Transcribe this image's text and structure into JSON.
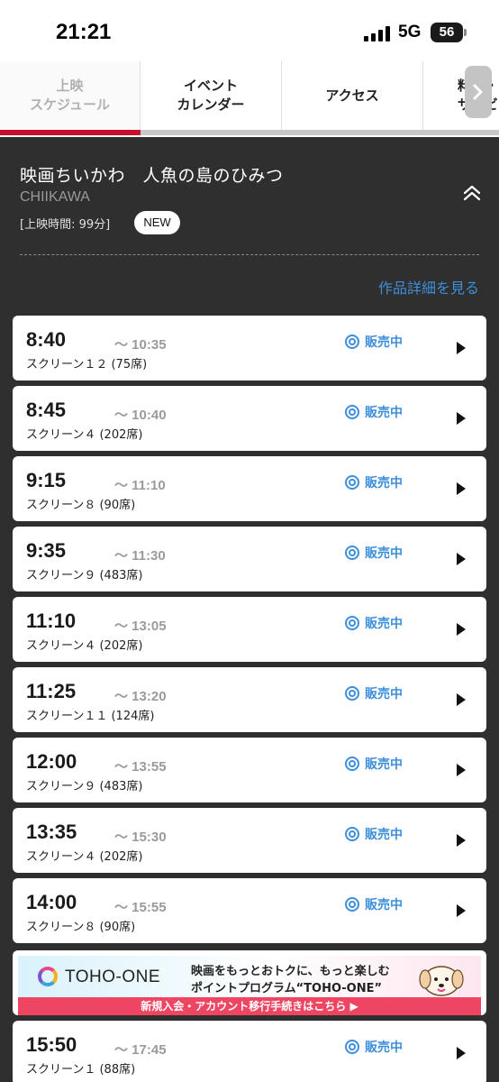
{
  "status_bar": {
    "time": "21:21",
    "network": "5G",
    "battery": "56"
  },
  "tabs": [
    {
      "label": "上映\nスケジュール",
      "active": true
    },
    {
      "label": "イベント\nカレンダー",
      "active": false
    },
    {
      "label": "アクセス",
      "active": false
    },
    {
      "label": "料金・\nサービ",
      "active": false
    }
  ],
  "movie": {
    "title": "映画ちいかわ　人魚の島のひみつ",
    "english_title": "CHIIKAWA",
    "runtime": "[上映時間: 99分]",
    "badge": "NEW",
    "detail_link": "作品詳細を見る"
  },
  "showtimes": [
    {
      "start": "8:40",
      "end": "〜 10:35",
      "screen": "スクリーン１２ (75席)",
      "status": "販売中"
    },
    {
      "start": "8:45",
      "end": "〜 10:40",
      "screen": "スクリーン４ (202席)",
      "status": "販売中"
    },
    {
      "start": "9:15",
      "end": "〜 11:10",
      "screen": "スクリーン８ (90席)",
      "status": "販売中"
    },
    {
      "start": "9:35",
      "end": "〜 11:30",
      "screen": "スクリーン９ (483席)",
      "status": "販売中"
    },
    {
      "start": "11:10",
      "end": "〜 13:05",
      "screen": "スクリーン４ (202席)",
      "status": "販売中"
    },
    {
      "start": "11:25",
      "end": "〜 13:20",
      "screen": "スクリーン１１ (124席)",
      "status": "販売中"
    },
    {
      "start": "12:00",
      "end": "〜 13:55",
      "screen": "スクリーン９ (483席)",
      "status": "販売中"
    },
    {
      "start": "13:35",
      "end": "〜 15:30",
      "screen": "スクリーン４ (202席)",
      "status": "販売中"
    },
    {
      "start": "14:00",
      "end": "〜 15:55",
      "screen": "スクリーン８ (90席)",
      "status": "販売中"
    },
    {
      "start": "15:50",
      "end": "〜 17:45",
      "screen": "スクリーン１ (88席)",
      "status": "販売中"
    }
  ],
  "banner": {
    "brand": "TOHO-ONE",
    "line1": "映画をもっとおトクに、もっと楽しむ",
    "line2": "ポイントプログラム“TOHO-ONE”",
    "cta": "新規入会・アカウント移行手続きはこちら ▶"
  },
  "colors": {
    "accent_blue": "#3d8fdc",
    "tab_active_red": "#c8102e",
    "background": "#2f2f2f",
    "banner_pink": "#ee4662"
  }
}
